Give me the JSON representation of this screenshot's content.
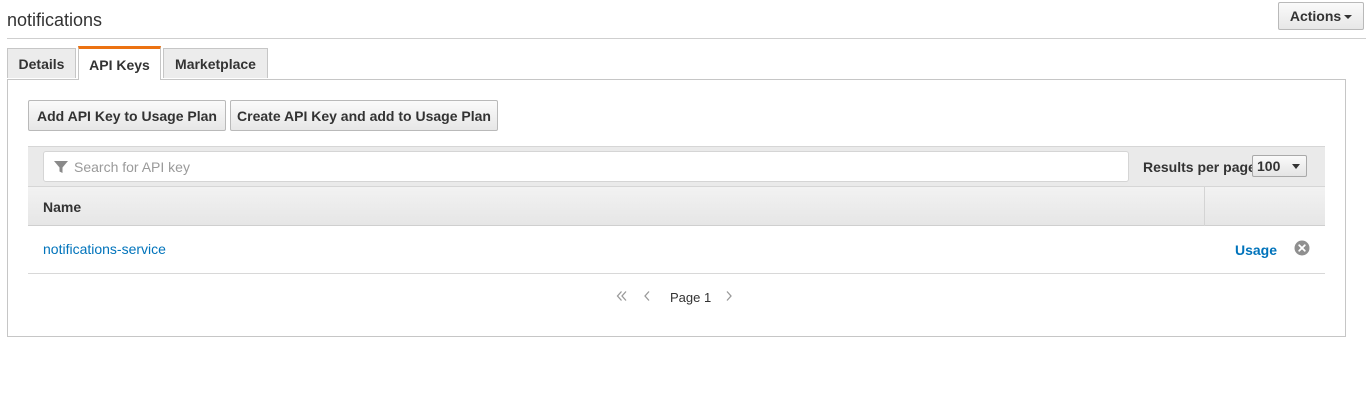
{
  "header": {
    "title": "notifications",
    "actions_label": "Actions"
  },
  "tabs": [
    {
      "label": "Details",
      "active": false
    },
    {
      "label": "API Keys",
      "active": true
    },
    {
      "label": "Marketplace",
      "active": false
    }
  ],
  "buttons": {
    "add_key": "Add API Key to Usage Plan",
    "create_key": "Create API Key and add to Usage Plan"
  },
  "search": {
    "placeholder": "Search for API key",
    "value": ""
  },
  "results_per_page": {
    "label": "Results per page",
    "selected": "100"
  },
  "table": {
    "columns": [
      "Name"
    ],
    "rows": [
      {
        "name": "notifications-service",
        "usage_label": "Usage"
      }
    ]
  },
  "pagination": {
    "page_label": "Page 1"
  },
  "icons": {
    "search": "filter-icon",
    "remove": "remove-circle-icon",
    "first_page": "double-chevron-left-icon",
    "prev_page": "chevron-left-icon",
    "next_page": "chevron-right-icon",
    "dropdown": "caret-down-icon"
  },
  "colors": {
    "accent_tab": "#ec7211",
    "link": "#0073bb"
  }
}
